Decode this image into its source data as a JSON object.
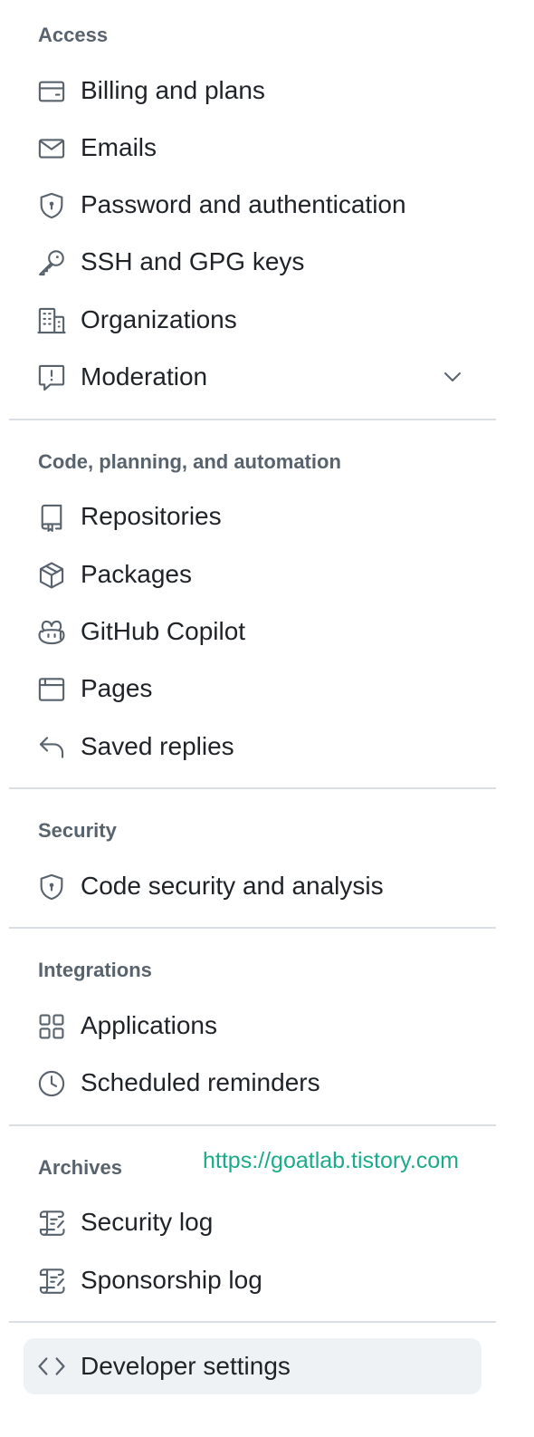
{
  "sections": {
    "access": {
      "heading": "Access",
      "items": [
        {
          "label": "Billing and plans",
          "icon": "credit-card-icon"
        },
        {
          "label": "Emails",
          "icon": "mail-icon"
        },
        {
          "label": "Password and authentication",
          "icon": "shield-lock-icon"
        },
        {
          "label": "SSH and GPG keys",
          "icon": "key-icon"
        },
        {
          "label": "Organizations",
          "icon": "organization-icon"
        },
        {
          "label": "Moderation",
          "icon": "report-icon",
          "expandable": true,
          "chevron": "chevron-down-icon"
        }
      ]
    },
    "code": {
      "heading": "Code, planning, and automation",
      "items": [
        {
          "label": "Repositories",
          "icon": "repo-icon"
        },
        {
          "label": "Packages",
          "icon": "package-icon"
        },
        {
          "label": "GitHub Copilot",
          "icon": "copilot-icon"
        },
        {
          "label": "Pages",
          "icon": "browser-icon"
        },
        {
          "label": "Saved replies",
          "icon": "reply-icon"
        }
      ]
    },
    "security": {
      "heading": "Security",
      "items": [
        {
          "label": "Code security and analysis",
          "icon": "shield-lock-icon"
        }
      ]
    },
    "integrations": {
      "heading": "Integrations",
      "items": [
        {
          "label": "Applications",
          "icon": "apps-icon"
        },
        {
          "label": "Scheduled reminders",
          "icon": "clock-icon"
        }
      ]
    },
    "archives": {
      "heading": "Archives",
      "items": [
        {
          "label": "Security log",
          "icon": "log-icon"
        },
        {
          "label": "Sponsorship log",
          "icon": "log-icon"
        }
      ]
    },
    "developer": {
      "items": [
        {
          "label": "Developer settings",
          "icon": "code-icon",
          "active": true
        }
      ]
    }
  },
  "watermark": {
    "text": "https://goatlab.tistory.com",
    "color": "#1aab8a"
  },
  "colors": {
    "text": "#1f2328",
    "heading": "#59636e",
    "divider": "#d8dee4",
    "active_bg": "#eff2f5"
  }
}
